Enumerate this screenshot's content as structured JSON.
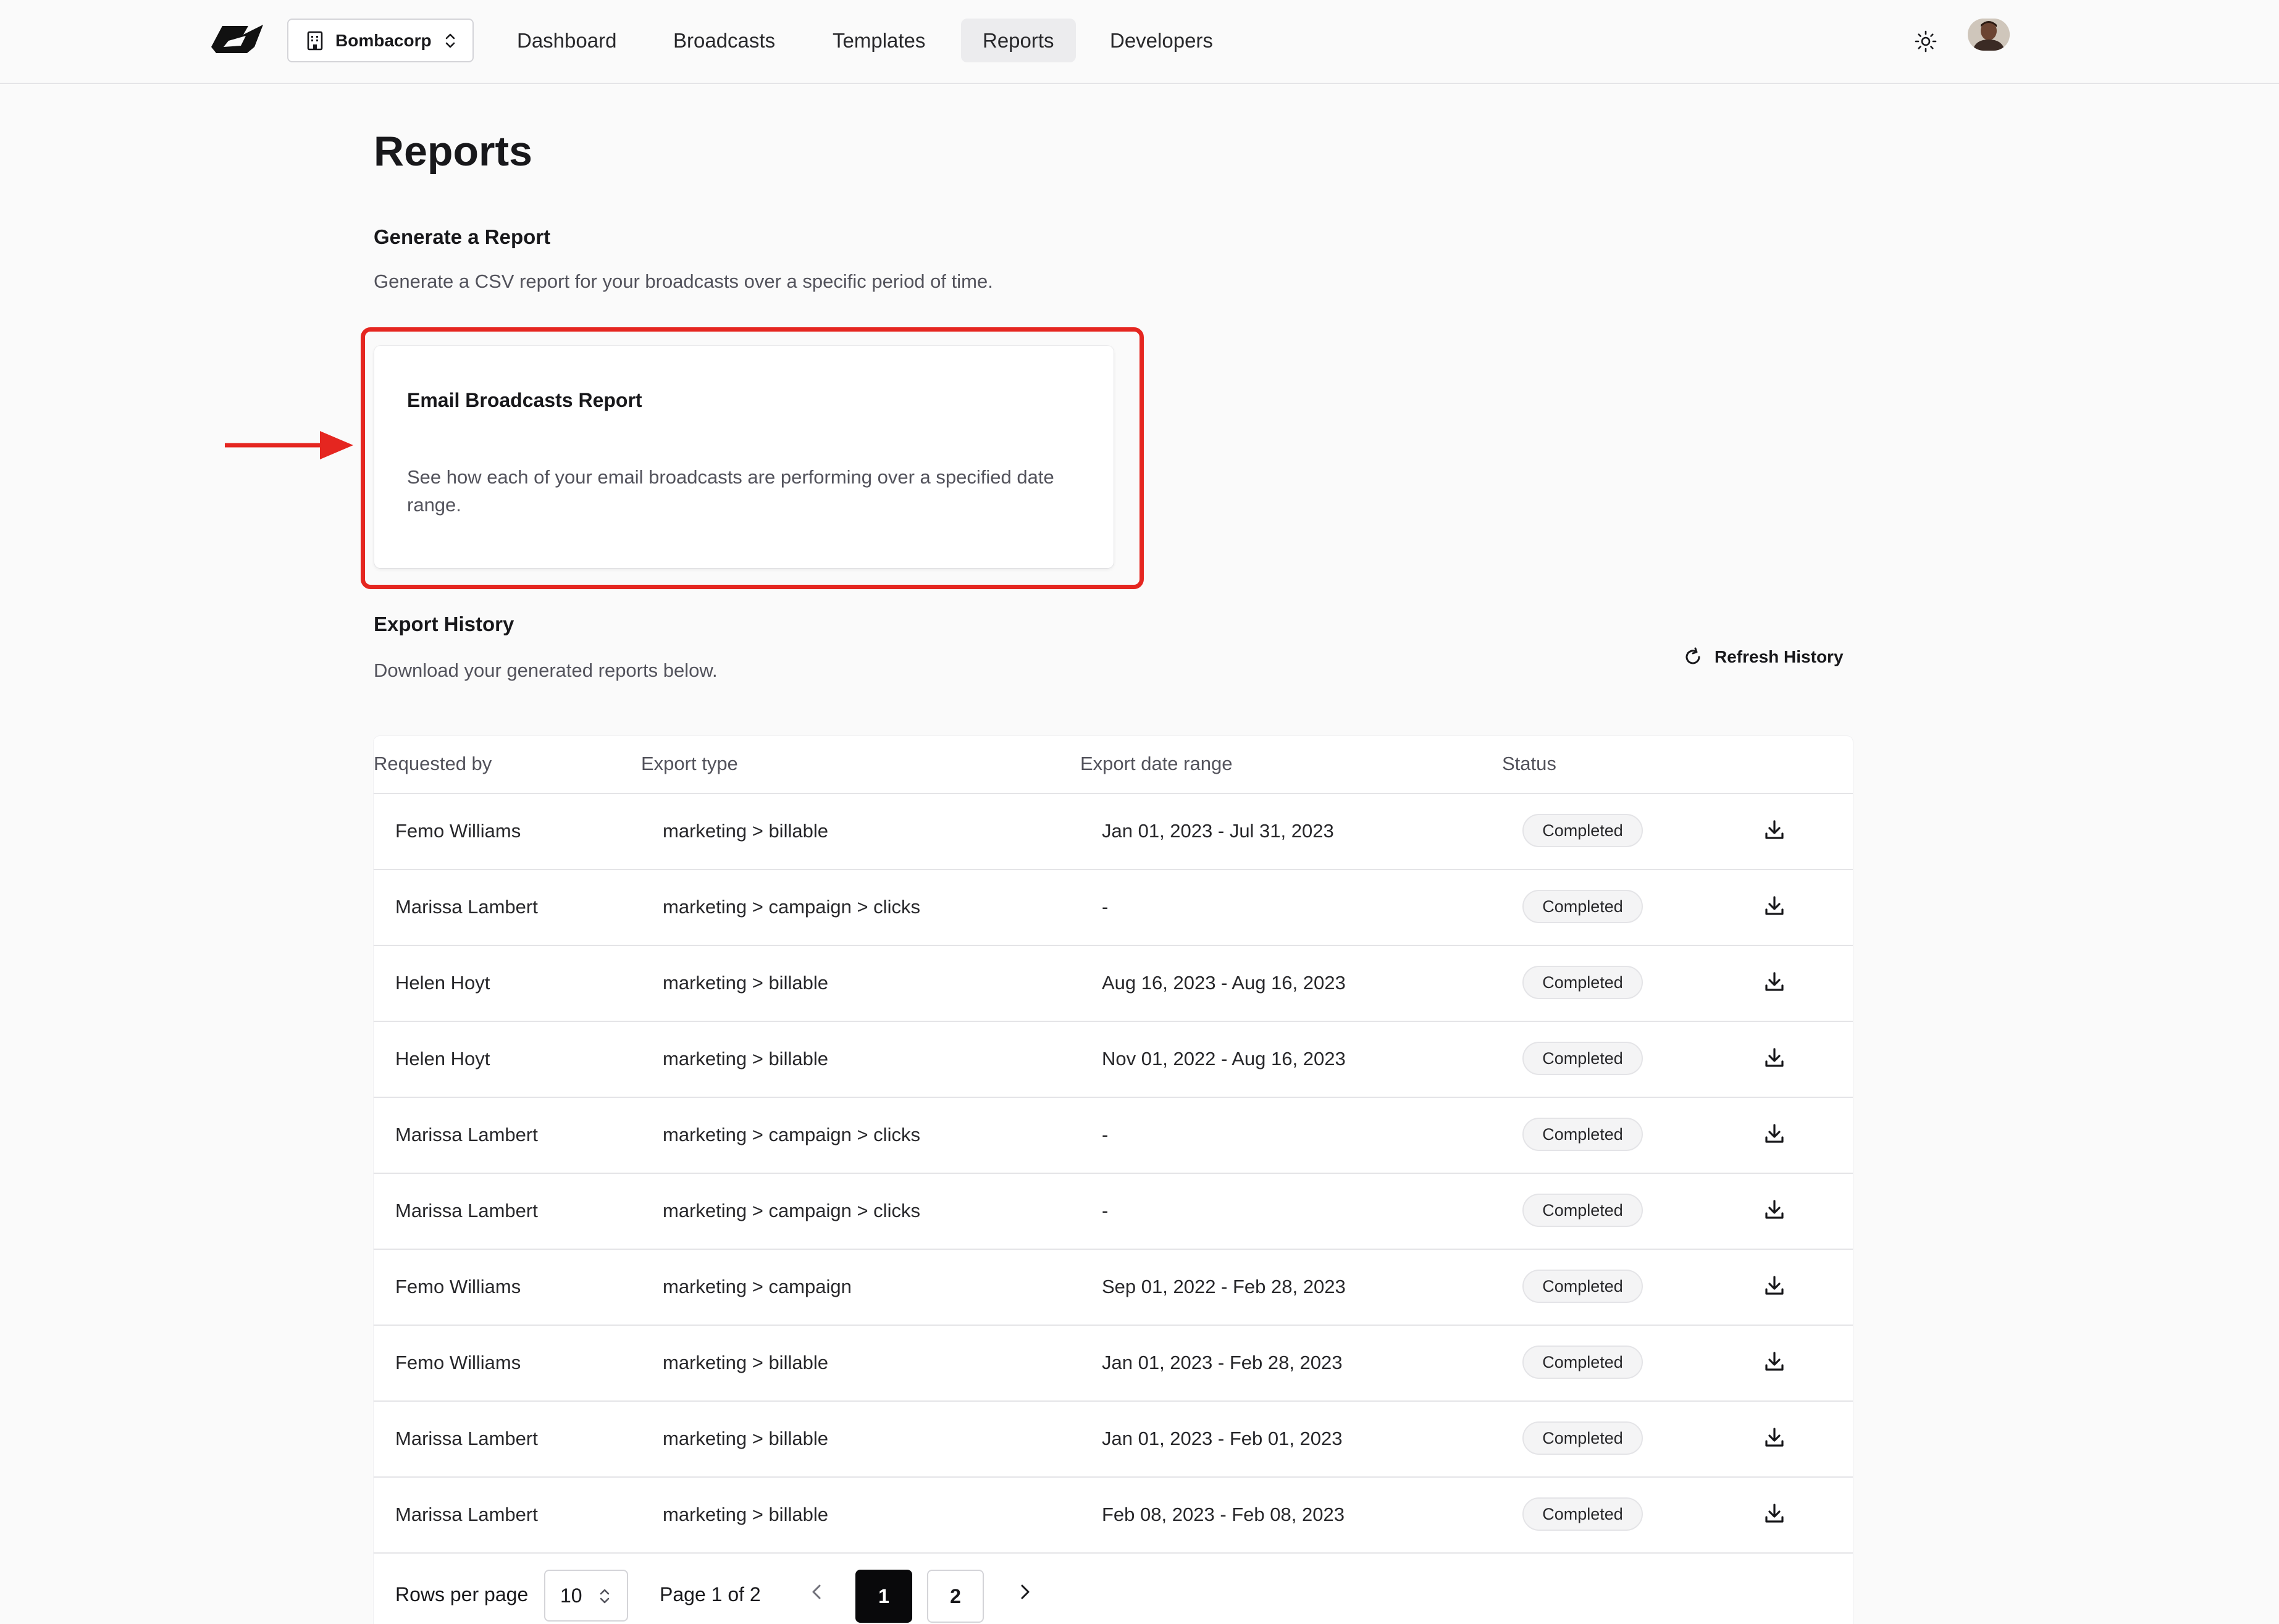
{
  "header": {
    "org_name": "Bombacorp",
    "nav": [
      {
        "label": "Dashboard",
        "active": false
      },
      {
        "label": "Broadcasts",
        "active": false
      },
      {
        "label": "Templates",
        "active": false
      },
      {
        "label": "Reports",
        "active": true
      },
      {
        "label": "Developers",
        "active": false
      }
    ],
    "icons": [
      "logo",
      "building-icon",
      "chevron-updown-icon",
      "sun-icon",
      "avatar"
    ]
  },
  "page": {
    "title": "Reports",
    "generate": {
      "title": "Generate a Report",
      "description": "Generate a CSV report for your broadcasts over a specific period of time."
    },
    "report_card": {
      "title": "Email Broadcasts Report",
      "description": "See how each of your email broadcasts are performing over a specified date range."
    },
    "history": {
      "title": "Export History",
      "description": "Download your generated reports below.",
      "refresh_label": "Refresh History"
    }
  },
  "table": {
    "headers": [
      "Requested by",
      "Export type",
      "Export date range",
      "Status"
    ],
    "rows": [
      {
        "requested_by": "Femo Williams",
        "export_type": "marketing > billable",
        "date_range": "Jan 01, 2023 - Jul 31, 2023",
        "status": "Completed"
      },
      {
        "requested_by": "Marissa Lambert",
        "export_type": "marketing > campaign > clicks",
        "date_range": "-",
        "status": "Completed"
      },
      {
        "requested_by": "Helen Hoyt",
        "export_type": "marketing > billable",
        "date_range": "Aug 16, 2023 - Aug 16, 2023",
        "status": "Completed"
      },
      {
        "requested_by": "Helen Hoyt",
        "export_type": "marketing > billable",
        "date_range": "Nov 01, 2022 - Aug 16, 2023",
        "status": "Completed"
      },
      {
        "requested_by": "Marissa Lambert",
        "export_type": "marketing > campaign > clicks",
        "date_range": "-",
        "status": "Completed"
      },
      {
        "requested_by": "Marissa Lambert",
        "export_type": "marketing > campaign > clicks",
        "date_range": "-",
        "status": "Completed"
      },
      {
        "requested_by": "Femo Williams",
        "export_type": "marketing > campaign",
        "date_range": "Sep 01, 2022 - Feb 28, 2023",
        "status": "Completed"
      },
      {
        "requested_by": "Femo Williams",
        "export_type": "marketing > billable",
        "date_range": "Jan 01, 2023 - Feb 28, 2023",
        "status": "Completed"
      },
      {
        "requested_by": "Marissa Lambert",
        "export_type": "marketing > billable",
        "date_range": "Jan 01, 2023 - Feb 01, 2023",
        "status": "Completed"
      },
      {
        "requested_by": "Marissa Lambert",
        "export_type": "marketing > billable",
        "date_range": "Feb 08, 2023 - Feb 08, 2023",
        "status": "Completed"
      }
    ]
  },
  "pagination": {
    "rows_per_page_label": "Rows per page",
    "rows_per_page_value": "10",
    "page_of": "Page 1 of 2",
    "pages": [
      "1",
      "2"
    ],
    "current_page": "1"
  },
  "colors": {
    "highlight": "#e52620",
    "accent_dark": "#09090b",
    "background": "#fafafa"
  }
}
